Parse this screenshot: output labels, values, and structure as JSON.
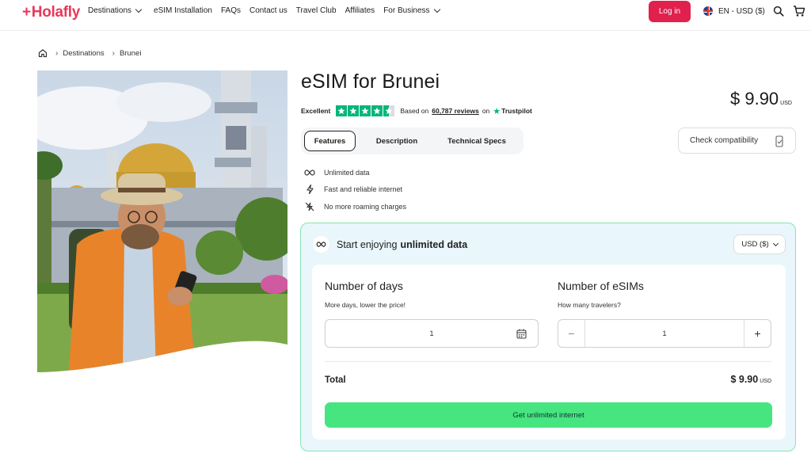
{
  "nav": {
    "logo": "Holafly",
    "links": [
      {
        "label": "Destinations",
        "dropdown": true
      },
      {
        "label": "eSIM Installation",
        "dropdown": false
      },
      {
        "label": "FAQs",
        "dropdown": false
      },
      {
        "label": "Contact us",
        "dropdown": false
      },
      {
        "label": "Travel Club",
        "dropdown": false
      },
      {
        "label": "Affiliates",
        "dropdown": false
      },
      {
        "label": "For Business",
        "dropdown": true
      }
    ],
    "login": "Log in",
    "language": "EN - USD ($)",
    "search_icon": "search-icon",
    "cart_icon": "cart-icon"
  },
  "breadcrumb": {
    "home_icon": "home-icon",
    "items": [
      "Destinations",
      "Brunei"
    ]
  },
  "product": {
    "title": "eSIM for Brunei",
    "rating_label": "Excellent",
    "stars": 4.5,
    "reviews_prefix": "Based on",
    "reviews_count": "60,787 reviews",
    "reviews_on": "on",
    "trustpilot": "Trustpilot",
    "price": "$ 9.90",
    "price_currency": "USD"
  },
  "tabs": [
    "Features",
    "Description",
    "Technical Specs"
  ],
  "compat_button": "Check compatibility",
  "features": [
    {
      "icon": "infinity-icon",
      "label": "Unlimited data"
    },
    {
      "icon": "lightning-icon",
      "label": "Fast and reliable internet"
    },
    {
      "icon": "no-roaming-icon",
      "label": "No more roaming charges"
    }
  ],
  "plan": {
    "headline_prefix": "Start enjoying",
    "headline_bold": "unlimited data",
    "currency_select": "USD ($)",
    "days_label": "Number of days",
    "days_sub": "More days, lower the price!",
    "days_value": "1",
    "esims_label": "Number of eSIMs",
    "esims_sub": "How many travelers?",
    "esims_value": "1",
    "minus": "−",
    "plus": "+",
    "total_label": "Total",
    "total_value": "$ 9.90",
    "total_currency": "USD",
    "cta": "Get unlimited internet"
  },
  "colors": {
    "brand": "#e8385b",
    "login": "#e1204e",
    "cta": "#46e580",
    "plan_bg": "#e9f6fb",
    "plan_border": "#86e4b0",
    "trustpilot": "#00b67a"
  }
}
